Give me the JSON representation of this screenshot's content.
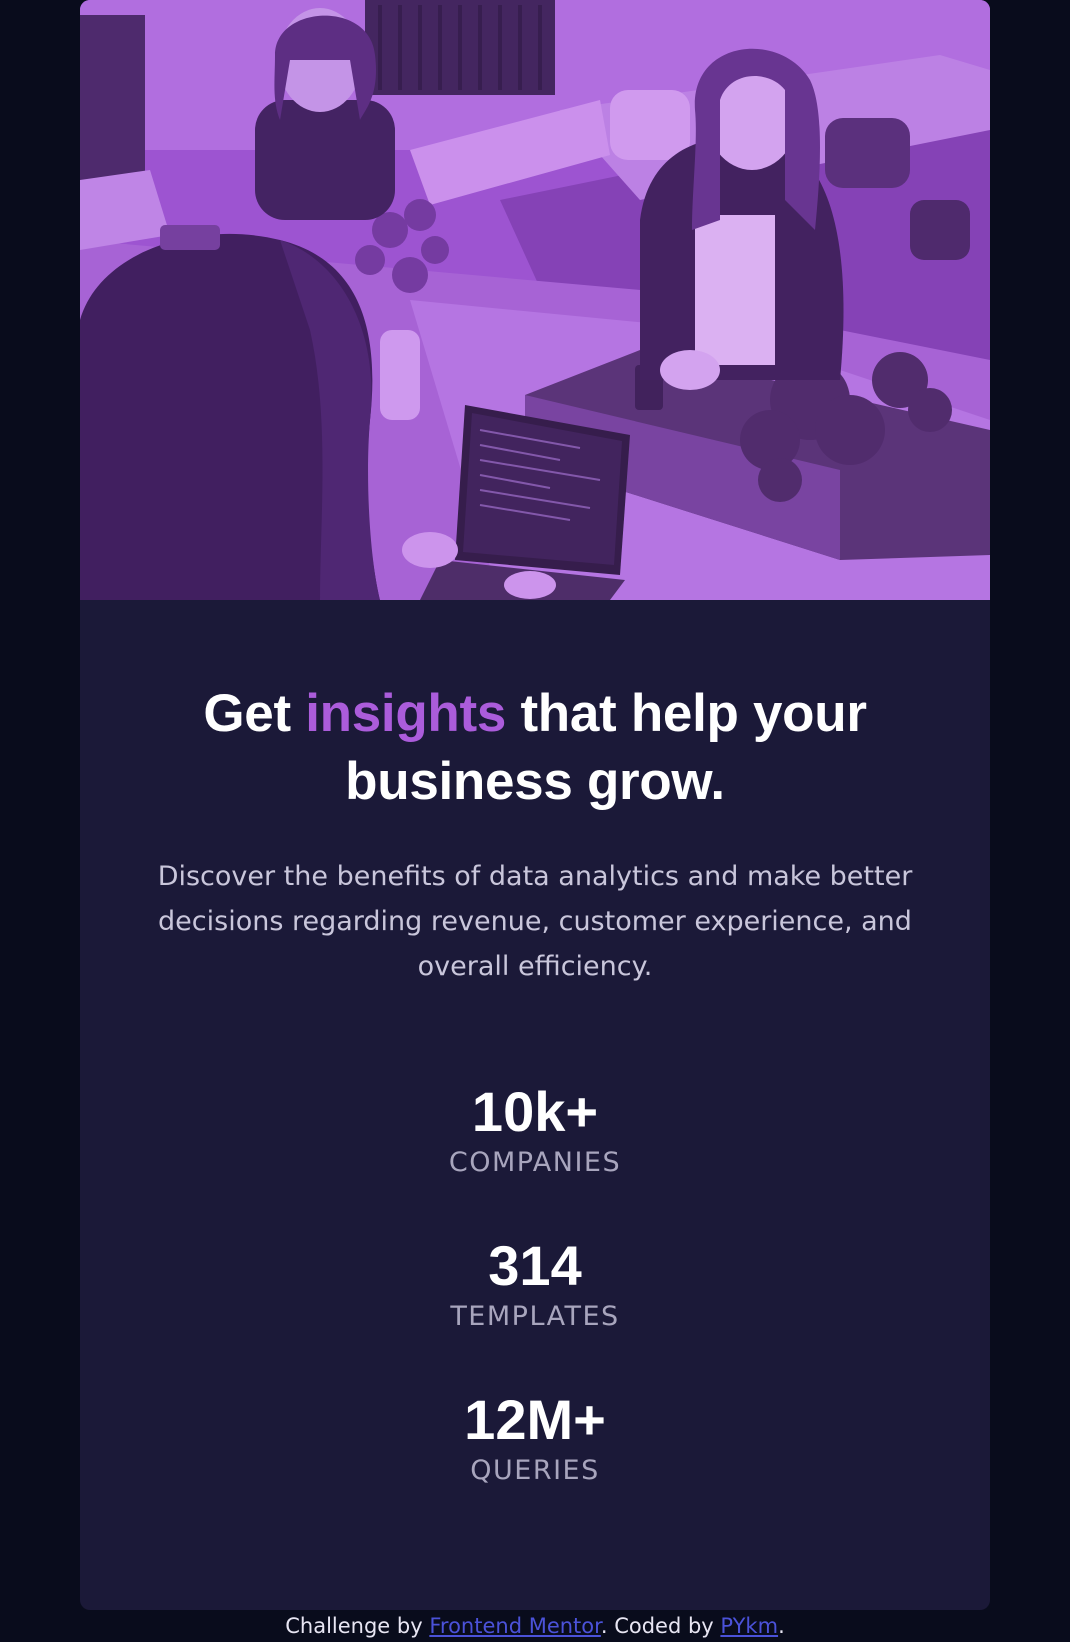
{
  "hero": {
    "image_alt": "three women working on laptops at a desk",
    "tint_color": "#aa5cdb"
  },
  "headline": {
    "before": "Get ",
    "accent": "insights",
    "after": " that help your business grow."
  },
  "description": "Discover the benefits of data analytics and make better decisions regarding revenue, customer experience, and overall efficiency.",
  "stats": [
    {
      "value": "10k+",
      "label": "COMPANIES"
    },
    {
      "value": "314",
      "label": "TEMPLATES"
    },
    {
      "value": "12M+",
      "label": "QUERIES"
    }
  ],
  "attribution": {
    "prefix": "Challenge by ",
    "link1": "Frontend Mentor",
    "middle": ". Coded by ",
    "link2": "PYkm",
    "suffix": "."
  },
  "colors": {
    "page_bg": "#090c1c",
    "card_bg": "#1b1938",
    "accent": "#ab5cdb"
  }
}
